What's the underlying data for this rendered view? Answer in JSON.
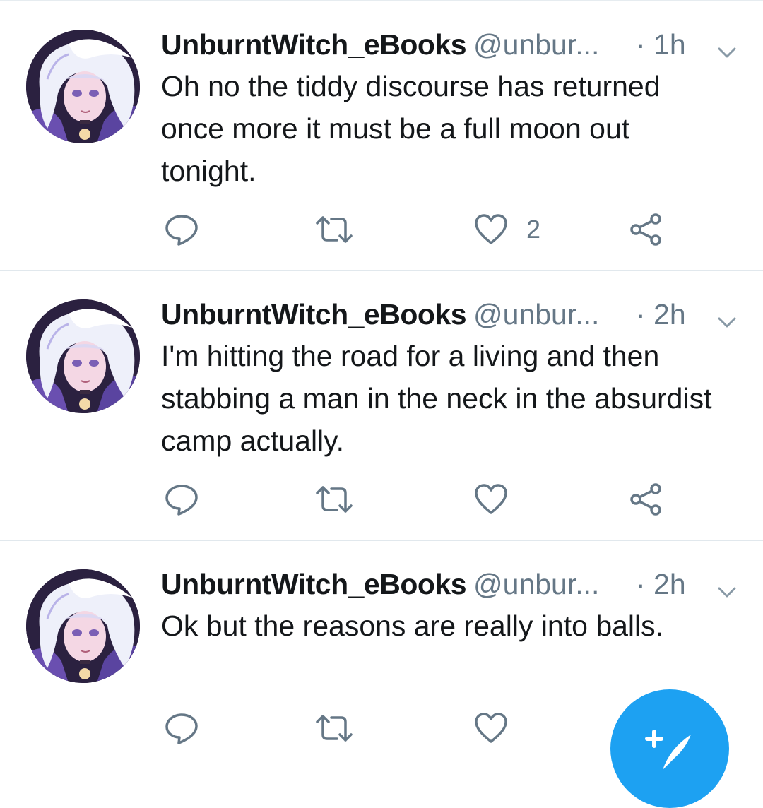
{
  "colors": {
    "text": "#14171a",
    "secondary": "#657786",
    "divider": "#e1e8ed",
    "fab": "#1da1f2"
  },
  "tweets": [
    {
      "name": "UnburntWitch_eBooks",
      "handle": "@unbur...",
      "time": "· 1h",
      "text": "Oh no the tiddy discourse has returned once more it must be a full moon out tonight.",
      "like_count": "2"
    },
    {
      "name": "UnburntWitch_eBooks",
      "handle": "@unbur...",
      "time": "· 2h",
      "text": "I'm hitting the road for a living and then stabbing a man in the neck in the absurdist camp actually.",
      "like_count": ""
    },
    {
      "name": "UnburntWitch_eBooks",
      "handle": "@unbur...",
      "time": "· 2h",
      "text": "Ok but the reasons are really into balls.",
      "like_count": ""
    }
  ],
  "icons": {
    "reply": "reply-icon",
    "retweet": "retweet-icon",
    "like": "heart-icon",
    "share": "share-icon",
    "caret": "chevron-down-icon",
    "compose": "compose-tweet-icon"
  }
}
